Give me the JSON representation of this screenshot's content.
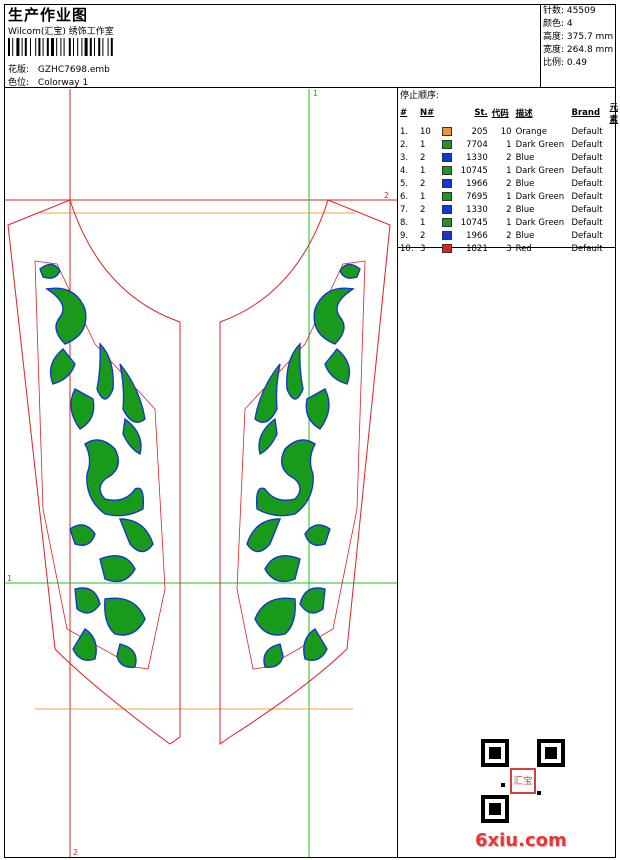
{
  "header": {
    "title": "生产作业图",
    "subtitle": "Wilcom(汇宝) 绣饰工作室",
    "design_label": "花版:",
    "design_value": "GZHC7698.emb",
    "colorway_label": "色位:",
    "colorway_value": "Colorway 1"
  },
  "stats": [
    {
      "label": "针数:",
      "value": "45509"
    },
    {
      "label": "颜色:",
      "value": "4"
    },
    {
      "label": "高度:",
      "value": "375.7 mm"
    },
    {
      "label": "宽度:",
      "value": "264.8 mm"
    },
    {
      "label": "比例:",
      "value": "0.49"
    }
  ],
  "sequence": {
    "title": "停止顺序:",
    "headers": [
      "#",
      "N#",
      "",
      "St.",
      "代码",
      "描述",
      "Brand",
      "元素"
    ],
    "rows": [
      {
        "no": "1.",
        "n": "10",
        "color": "#f0923a",
        "st": "205",
        "code": "10",
        "desc": "Orange",
        "brand": "Default"
      },
      {
        "no": "2.",
        "n": "1",
        "color": "#1a9a1a",
        "st": "7704",
        "code": "1",
        "desc": "Dark Green",
        "brand": "Default"
      },
      {
        "no": "3.",
        "n": "2",
        "color": "#1436d8",
        "st": "1330",
        "code": "2",
        "desc": "Blue",
        "brand": "Default"
      },
      {
        "no": "4.",
        "n": "1",
        "color": "#1a9a1a",
        "st": "10745",
        "code": "1",
        "desc": "Dark Green",
        "brand": "Default"
      },
      {
        "no": "5.",
        "n": "2",
        "color": "#1436d8",
        "st": "1966",
        "code": "2",
        "desc": "Blue",
        "brand": "Default"
      },
      {
        "no": "6.",
        "n": "1",
        "color": "#1a9a1a",
        "st": "7695",
        "code": "1",
        "desc": "Dark Green",
        "brand": "Default"
      },
      {
        "no": "7.",
        "n": "2",
        "color": "#1436d8",
        "st": "1330",
        "code": "2",
        "desc": "Blue",
        "brand": "Default"
      },
      {
        "no": "8.",
        "n": "1",
        "color": "#1a9a1a",
        "st": "10745",
        "code": "1",
        "desc": "Dark Green",
        "brand": "Default"
      },
      {
        "no": "9.",
        "n": "2",
        "color": "#1436d8",
        "st": "1966",
        "code": "2",
        "desc": "Blue",
        "brand": "Default"
      },
      {
        "no": "10.",
        "n": "3",
        "color": "#e81e1e",
        "st": "1821",
        "code": "3",
        "desc": "Red",
        "brand": "Default"
      }
    ]
  },
  "guides": {
    "top_marker": "1",
    "right_marker": "2",
    "left_marker": "1",
    "bottom_marker": "2"
  },
  "watermark": {
    "text": "6xiu.com",
    "seal_text": "汇宝"
  },
  "colors": {
    "outline": "#e02020",
    "guide_green": "#20c020",
    "guide_orange": "#f0a040",
    "fill_green": "#1a9a1a",
    "edge_blue": "#1436d8"
  }
}
